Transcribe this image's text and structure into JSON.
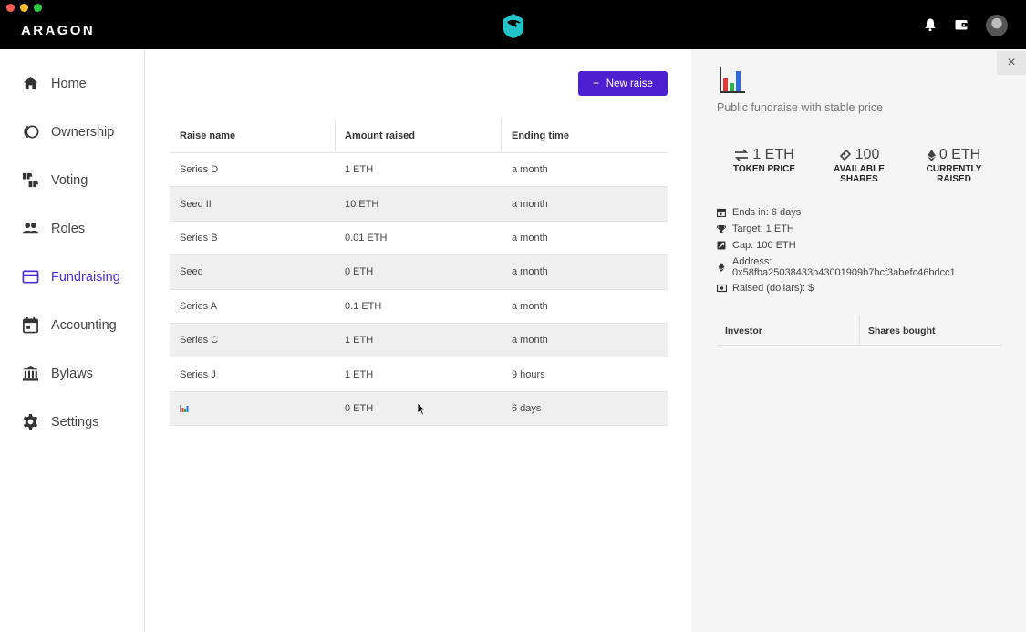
{
  "window": {
    "brand": "ARAGON"
  },
  "topbar_icons": [
    "bell-icon",
    "wallet-icon",
    "avatar"
  ],
  "sidebar": {
    "items": [
      {
        "label": "Home",
        "icon": "home-icon",
        "active": false
      },
      {
        "label": "Ownership",
        "icon": "ownership-icon",
        "active": false
      },
      {
        "label": "Voting",
        "icon": "voting-icon",
        "active": false
      },
      {
        "label": "Roles",
        "icon": "roles-icon",
        "active": false
      },
      {
        "label": "Fundraising",
        "icon": "fundraising-icon",
        "active": true
      },
      {
        "label": "Accounting",
        "icon": "accounting-icon",
        "active": false
      },
      {
        "label": "Bylaws",
        "icon": "bylaws-icon",
        "active": false
      },
      {
        "label": "Settings",
        "icon": "settings-icon",
        "active": false
      }
    ]
  },
  "main": {
    "new_raise_button": {
      "icon": "+",
      "label": "New raise"
    },
    "table": {
      "columns": [
        "Raise name",
        "Amount raised",
        "Ending time"
      ],
      "rows": [
        {
          "name": "Series D",
          "amount": "1 ETH",
          "ending": "a month"
        },
        {
          "name": "Seed II",
          "amount": "10 ETH",
          "ending": "a month"
        },
        {
          "name": "Series B",
          "amount": "0.01 ETH",
          "ending": "a month"
        },
        {
          "name": "Seed",
          "amount": "0 ETH",
          "ending": "a month"
        },
        {
          "name": "Series A",
          "amount": "0.1 ETH",
          "ending": "a month"
        },
        {
          "name": "Series C",
          "amount": "1 ETH",
          "ending": "a month"
        },
        {
          "name": "Series J",
          "amount": "1 ETH",
          "ending": "9 hours"
        },
        {
          "name": "",
          "name_icon": "chart-icon",
          "amount": "0 ETH",
          "ending": "6 days"
        }
      ]
    }
  },
  "panel": {
    "close_label": "×",
    "subtitle": "Public fundraise with stable price",
    "stats": [
      {
        "value": "1 ETH",
        "caption": "TOKEN PRICE",
        "icon": "exchange-icon"
      },
      {
        "value": "100",
        "caption": "AVAILABLE SHARES",
        "icon": "ticket-icon"
      },
      {
        "value": "0 ETH",
        "caption": "CURRENTLY RAISED",
        "icon": "ethereum-icon"
      }
    ],
    "info": {
      "ends_in": "Ends in: 6 days",
      "target": "Target: 1 ETH",
      "cap": "Cap: 100 ETH",
      "address_label": "Address:",
      "address": "0x58fba25038433b43001909b7bcf3abefc46bdcc1",
      "raised_dollars": "Raised (dollars): $"
    },
    "investors_table": {
      "columns": [
        "Investor",
        "Shares bought"
      ]
    }
  },
  "colors": {
    "accent": "#4d1fd0",
    "active_nav": "#4b2fd6",
    "topbar": "#000000"
  }
}
